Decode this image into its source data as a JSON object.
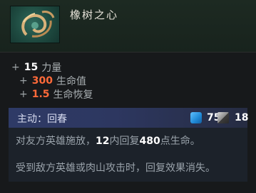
{
  "item": {
    "name": "橡树之心",
    "icon": "heart-of-tarrasque-icon"
  },
  "stats": [
    {
      "prefix": "+",
      "value": "15",
      "label": "力量",
      "color": "#ffffff"
    },
    {
      "prefix": "+",
      "value": "300",
      "label": "生命值",
      "color": "#ff6a3a"
    },
    {
      "prefix": "+",
      "value": "1.5",
      "label": "生命恢复",
      "color": "#ff6a3a"
    }
  ],
  "active": {
    "label": "主动：回春",
    "mana_cost": "75",
    "cooldown": "18",
    "mana_icon": "mana-cost-icon",
    "cooldown_icon": "cooldown-icon"
  },
  "description": {
    "line1_a": "对友方英雄施放，",
    "line1_b": "12",
    "line1_c": "内回复",
    "line1_d": "480",
    "line1_e": "点生命。",
    "line2": "受到敌方英雄或肉山攻击时，回复效果消失。"
  },
  "colors": {
    "accent_orange": "#ff6a3a",
    "active_bar": "#2e3a66",
    "background": "#17191b"
  }
}
